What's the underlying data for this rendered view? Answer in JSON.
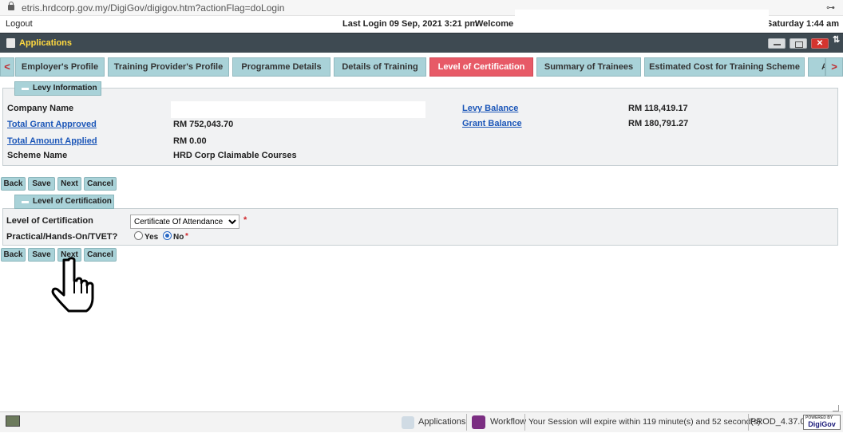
{
  "browser": {
    "url": "etris.hrdcorp.gov.my/DigiGov/digigov.htm?actionFlag=doLogin"
  },
  "header": {
    "logout": "Logout",
    "last_login": "Last Login 09 Sep, 2021 3:21 pm",
    "welcome": "Welcome",
    "datetime": ", Saturday 1:44 am"
  },
  "app": {
    "title": "Applications",
    "sort_icon": "⇅"
  },
  "tabs": [
    {
      "label": "Employer's Profile"
    },
    {
      "label": "Training Provider's Profile"
    },
    {
      "label": "Programme Details"
    },
    {
      "label": "Details of Training"
    },
    {
      "label": "Level of Certification"
    },
    {
      "label": "Summary of Trainees"
    },
    {
      "label": "Estimated Cost for Training Scheme"
    },
    {
      "label": "A"
    }
  ],
  "nav": {
    "left": "<",
    "right": ">"
  },
  "levy": {
    "title": "Levy Information",
    "company_name_label": "Company Name",
    "total_grant_label": "Total Grant Approved",
    "total_grant_value": "RM 752,043.70",
    "total_applied_label": "Total Amount Applied",
    "total_applied_value": "RM 0.00",
    "scheme_label": "Scheme Name",
    "scheme_value": "HRD Corp Claimable Courses",
    "levy_balance_label": "Levy Balance",
    "levy_balance_value": "RM 118,419.17",
    "grant_balance_label": "Grant Balance",
    "grant_balance_value": "RM 180,791.27"
  },
  "buttons": {
    "back": "Back",
    "save": "Save",
    "next": "Next",
    "cancel": "Cancel"
  },
  "cert": {
    "title": "Level of Certification",
    "level_label": "Level of Certification",
    "level_value": "Certificate Of Attendance",
    "practical_label": "Practical/Hands-On/TVET?",
    "yes": "Yes",
    "no": "No",
    "required": "*"
  },
  "statusbar": {
    "applications": "Applications",
    "workflow": "Workflow",
    "session": "Your Session will expire within 119 minute(s) and 52 second(s).",
    "version": "PROD_4.37.0",
    "logo": "DigiGov",
    "logo_small": "POWERED BY"
  }
}
